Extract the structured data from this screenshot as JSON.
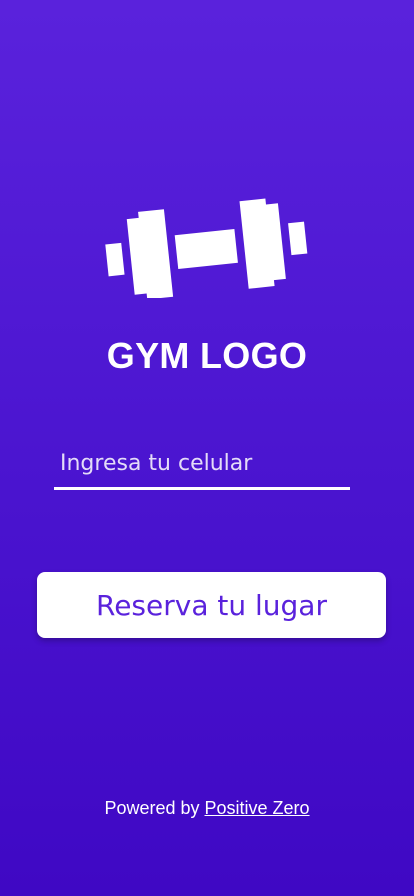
{
  "brand": {
    "icon": "dumbbell-icon",
    "title": "GYM LOGO"
  },
  "form": {
    "phone_placeholder": "Ingresa tu celular",
    "submit_label": "Reserva tu lugar"
  },
  "footer": {
    "prefix": "Powered by",
    "link_label": "Positive Zero"
  },
  "colors": {
    "background_top": "#5a22dc",
    "background_bottom": "#3f08c4",
    "accent": "#5a22dc",
    "text": "#ffffff"
  }
}
